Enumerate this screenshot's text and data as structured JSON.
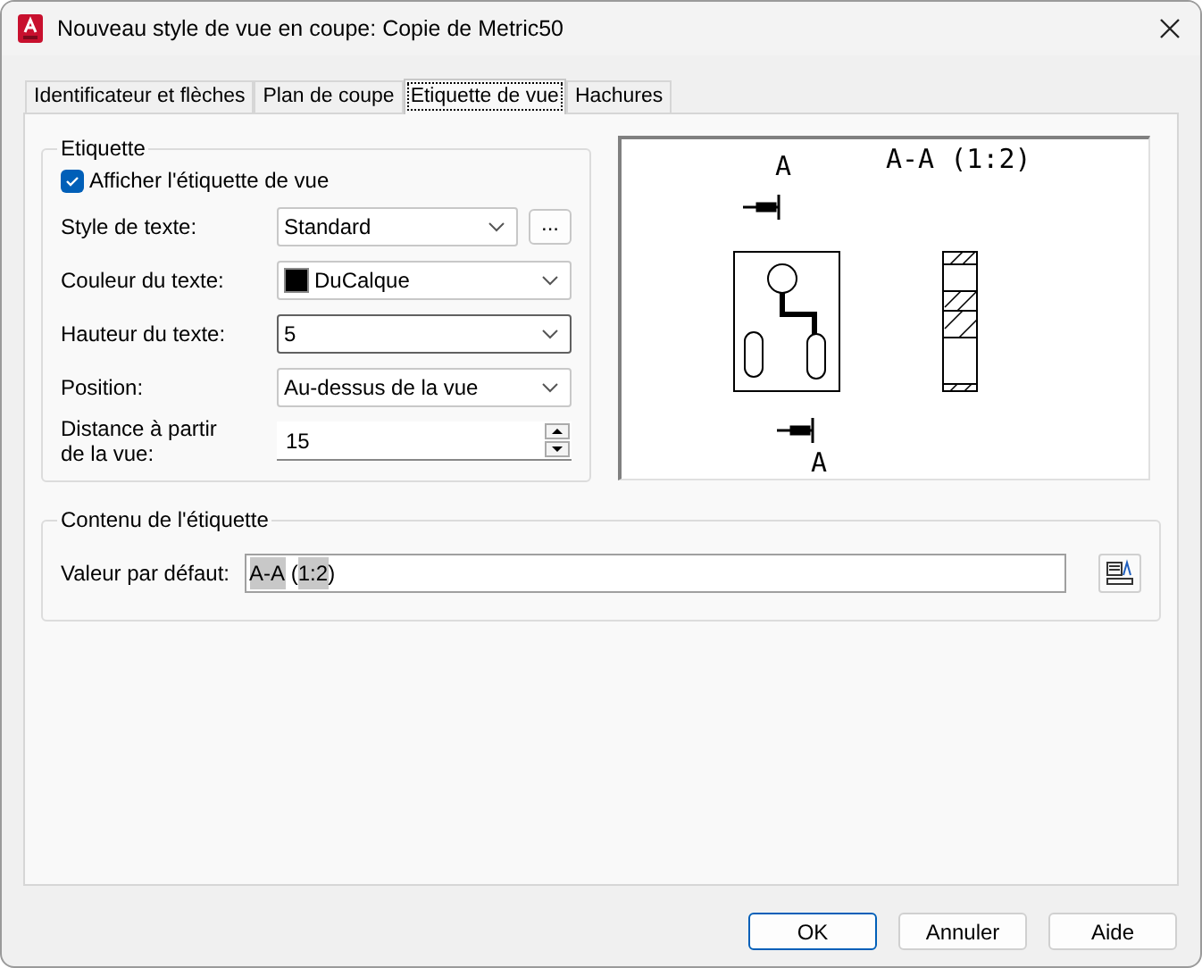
{
  "window": {
    "title": "Nouveau style de vue en coupe: Copie de Metric50"
  },
  "tabs": [
    {
      "label": "Identificateur et flèches",
      "selected": false
    },
    {
      "label": "Plan de coupe",
      "selected": false
    },
    {
      "label": "Etiquette de vue",
      "selected": true
    },
    {
      "label": "Hachures",
      "selected": false
    }
  ],
  "label_group": {
    "title": "Etiquette",
    "show_label": {
      "label": "Afficher l'étiquette de vue",
      "checked": true
    },
    "fields": [
      {
        "kind": "combo",
        "label": "Style de texte:",
        "value": "Standard",
        "more_button": "..."
      },
      {
        "kind": "color",
        "label": "Couleur du texte:",
        "value": "DuCalque",
        "color": "#000000"
      },
      {
        "kind": "combo",
        "label": "Hauteur du texte:",
        "value": "5",
        "focused": true
      },
      {
        "kind": "combo",
        "label": "Position:",
        "value": "Au-dessus de la vue"
      },
      {
        "kind": "spin",
        "label": "Distance à partir de la vue:",
        "value": "15"
      }
    ]
  },
  "preview": {
    "title": "A-A (1:2)",
    "top_marker": "A",
    "bottom_marker": "A"
  },
  "content_group": {
    "title": "Contenu de l'étiquette",
    "label": "Valeur par défaut:",
    "value_parts": [
      {
        "text": "A-A",
        "field": true
      },
      {
        "text": " (",
        "field": false
      },
      {
        "text": "1:2",
        "field": true
      },
      {
        "text": ")",
        "field": false
      }
    ]
  },
  "buttons": [
    {
      "label": "OK",
      "default": true
    },
    {
      "label": "Annuler",
      "default": false
    },
    {
      "label": "Aide",
      "default": false
    }
  ]
}
